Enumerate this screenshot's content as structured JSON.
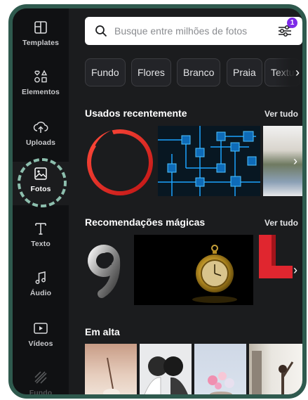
{
  "sidebar": {
    "items": [
      {
        "label": "Templates",
        "icon": "template-icon"
      },
      {
        "label": "Elementos",
        "icon": "shapes-icon"
      },
      {
        "label": "Uploads",
        "icon": "cloud-upload-icon"
      },
      {
        "label": "Fotos",
        "icon": "image-icon"
      },
      {
        "label": "Texto",
        "icon": "text-icon"
      },
      {
        "label": "Áudio",
        "icon": "music-note-icon"
      },
      {
        "label": "Vídeos",
        "icon": "video-icon"
      },
      {
        "label": "Fundo",
        "icon": "background-icon"
      }
    ],
    "active": "Fotos"
  },
  "search": {
    "placeholder": "Busque entre milhões de fotos",
    "filter_badge": "1"
  },
  "chips": [
    "Fundo",
    "Flores",
    "Branco",
    "Praia",
    "Textu"
  ],
  "sections": {
    "recent": {
      "title": "Usados recentemente",
      "see_all": "Ver tudo"
    },
    "magic": {
      "title": "Recomendações mágicas",
      "see_all": "Ver tudo"
    },
    "trending": {
      "title": "Em alta"
    }
  },
  "colors": {
    "frame_border": "#2f5a4e",
    "sidebar_bg": "#101113",
    "panel_bg": "#1b1c1e",
    "highlight_dash": "#8dbfae",
    "badge": "#7d2ae8"
  }
}
